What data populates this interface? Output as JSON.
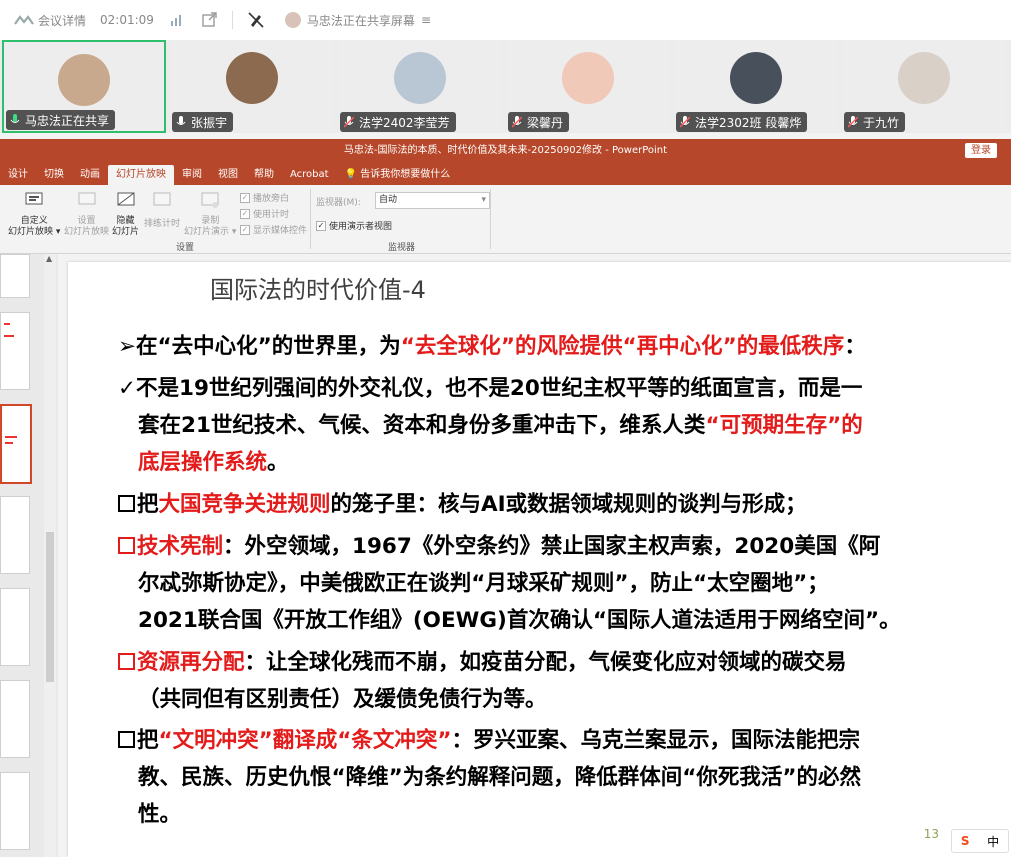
{
  "meeting": {
    "details_label": "会议详情",
    "timer": "02:01:09",
    "sharing_status": "马忠法正在共享屏幕"
  },
  "participants": [
    {
      "name": "马忠法正在共享",
      "mic": "speaking",
      "avatar_color": "#c9a98e"
    },
    {
      "name": "张振宇",
      "mic": "on",
      "avatar_color": "#8b6a4f"
    },
    {
      "name": "法学2402李莹芳",
      "mic": "muted",
      "avatar_color": "#b9c6d4"
    },
    {
      "name": "梁馨丹",
      "mic": "muted",
      "avatar_color": "#f0c9b8"
    },
    {
      "name": "法学2302班 段馨烨",
      "mic": "muted",
      "avatar_color": "#48505c"
    },
    {
      "name": "于九竹",
      "mic": "muted",
      "avatar_color": "#d9d0c8"
    }
  ],
  "ppt": {
    "title": "马忠法-国际法的本质、时代价值及其未来-20250902修改  -  PowerPoint",
    "login": "登录",
    "tabs": [
      "设计",
      "切换",
      "动画",
      "幻灯片放映",
      "审阅",
      "视图",
      "帮助",
      "Acrobat",
      "告诉我你想要做什么"
    ],
    "selected_tab": "幻灯片放映",
    "ribbon": {
      "custom_show": "自定义\n幻灯片放映",
      "setup_show": "设置\n幻灯片放映",
      "hide_slide": "隐藏\n幻灯片",
      "rehearse": "排练计时",
      "record": "录制\n幻灯片演示",
      "play_narrations": "播放旁白",
      "use_timings": "使用计时",
      "show_media_controls": "显示媒体控件",
      "setup_group": "设置",
      "monitor_label": "监视器(M):",
      "monitor_value": "自动",
      "presenter_view": "使用演示者视图",
      "monitors_group": "监视器"
    }
  },
  "slide": {
    "title": "国际法的时代价值-4",
    "page_number": "13",
    "p1": {
      "bullet": "➢",
      "a": "在“去中心化”的世界里，为",
      "b": "“去全球化”的风险提供“再中心化”的最低秩序",
      "c": "："
    },
    "p2": {
      "bullet": "✓",
      "a": "不是19世纪列强间的外交礼仪，也不是20世纪主权平等的纸面宣言，而是一",
      "b": "套在21世纪技术、气候、资本和身份多重冲击下，维系人类",
      "c": "“可预期生存”的",
      "d": "底层操作系统",
      "e": "。"
    },
    "p3": {
      "a": "把",
      "b": "大国竞争关进规则",
      "c": "的笼子里：核与AI或数据领域规则的谈判与形成；"
    },
    "p4": {
      "b": "技术宪制",
      "c": "：外空领域，1967《外空条约》禁止国家主权声索，2020美国《阿",
      "d": "尔忒弥斯协定》，中美俄欧正在谈判“月球采矿规则”，防止“太空圈地”；",
      "e": "2021联合国《开放工作组》(OEWG)首次确认“国际人道法适用于网络空间”。"
    },
    "p5": {
      "b": "资源再分配",
      "c": "：让全球化残而不崩，如疫苗分配，气候变化应对领域的碳交易",
      "d": "（共同但有区别责任）及缓债免债行为等。"
    },
    "p6": {
      "a": "把",
      "b": "“文明冲突”翻译成“条文冲突”",
      "c": "：罗兴亚案、乌克兰案显示，国际法能把宗",
      "d": "教、民族、历史仇恨“降维”为条约解释问题，降低群体间“你死我活”的必然",
      "e": "性。"
    }
  },
  "ime": {
    "logo": "S",
    "mode": "中"
  },
  "colors": {
    "ppt_accent": "#b7472a",
    "highlight_red": "#e31b1b",
    "active_border": "#2fbf6c"
  }
}
